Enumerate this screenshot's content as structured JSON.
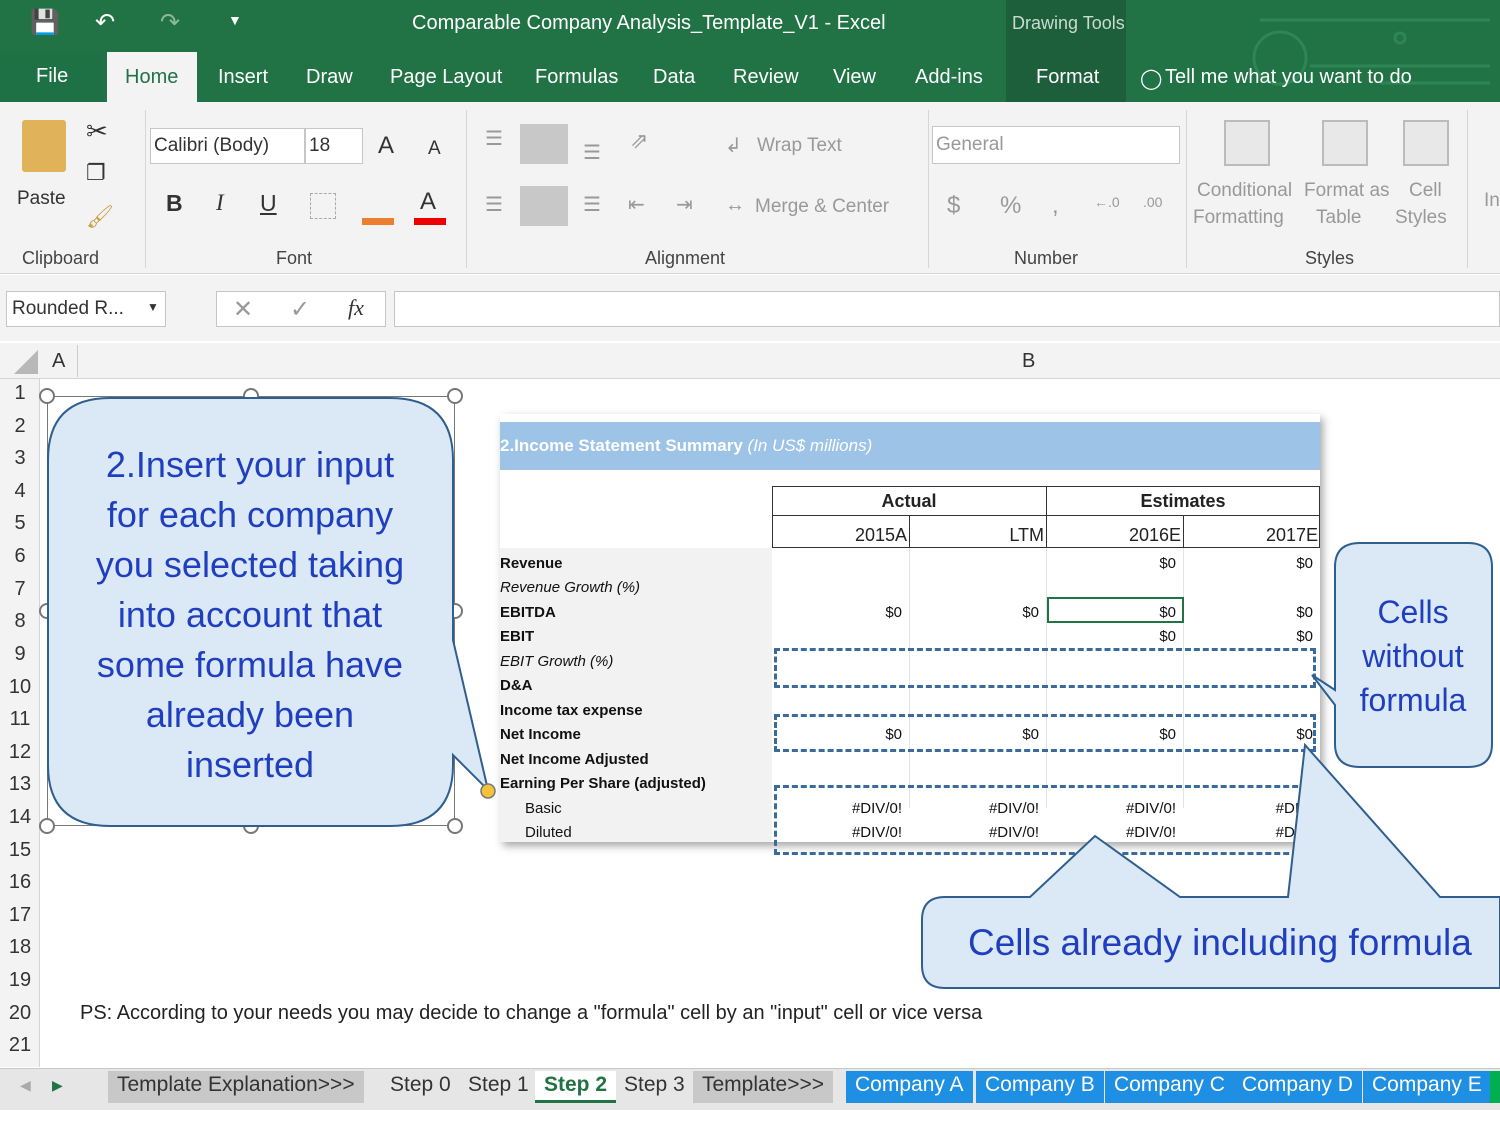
{
  "window": {
    "title": "Comparable Company Analysis_Template_V1 - Excel",
    "contextual": "Drawing Tools"
  },
  "tabs": [
    "File",
    "Home",
    "Insert",
    "Draw",
    "Page Layout",
    "Formulas",
    "Data",
    "Review",
    "View",
    "Add-ins",
    "Format"
  ],
  "tell_me": "Tell me what you want to do",
  "ribbon": {
    "paste": "Paste",
    "clipboard": "Clipboard",
    "font_name": "Calibri (Body)",
    "font_size": "18",
    "font": "Font",
    "wrap": "Wrap Text",
    "merge": "Merge & Center",
    "alignment": "Alignment",
    "number_format": "General",
    "number": "Number",
    "cond1": "Conditional",
    "cond2": "Formatting",
    "fmt1": "Format as",
    "fmt2": "Table",
    "cell1": "Cell",
    "cell2": "Styles",
    "styles": "Styles",
    "insert": "In"
  },
  "formula_bar": {
    "name_box": "Rounded R...",
    "fx": "fx"
  },
  "columns": [
    "A",
    "B"
  ],
  "rows": [
    "1",
    "2",
    "3",
    "4",
    "5",
    "6",
    "7",
    "8",
    "9",
    "10",
    "11",
    "12",
    "13",
    "14",
    "15",
    "16",
    "17",
    "18",
    "19",
    "20",
    "21"
  ],
  "callout_left": [
    "2.Insert your input",
    "for each company",
    "you selected taking",
    "into account that",
    "some formula have",
    "already been",
    "inserted"
  ],
  "callout_right": [
    "Cells",
    "without",
    "formula"
  ],
  "callout_bottom": "Cells already including formula",
  "table": {
    "title": "2.Income Statement Summary",
    "title_unit": "(In US$ millions)",
    "actual": "Actual",
    "estimates": "Estimates",
    "cols": [
      "2015A",
      "LTM",
      "2016E",
      "2017E"
    ],
    "rows": [
      {
        "label": "Revenue",
        "vals": [
          "",
          "",
          "$0",
          "$0"
        ]
      },
      {
        "label": "Revenue Growth (%)",
        "vals": [
          "",
          "",
          "",
          ""
        ]
      },
      {
        "label": "EBITDA",
        "vals": [
          "$0",
          "$0",
          "$0",
          "$0"
        ]
      },
      {
        "label": "EBIT",
        "vals": [
          "",
          "",
          "$0",
          "$0"
        ]
      },
      {
        "label": "EBIT Growth (%)",
        "vals": [
          "",
          "",
          "",
          ""
        ]
      },
      {
        "label": "D&A",
        "vals": [
          "",
          "",
          "",
          ""
        ]
      },
      {
        "label": "Income tax expense",
        "vals": [
          "",
          "",
          "",
          ""
        ]
      },
      {
        "label": "Net Income",
        "vals": [
          "$0",
          "$0",
          "$0",
          "$0"
        ]
      },
      {
        "label": "Net Income Adjusted",
        "vals": [
          "",
          "",
          "",
          ""
        ]
      },
      {
        "label": "Earning Per Share (adjusted)",
        "vals": [
          "",
          "",
          "",
          ""
        ]
      },
      {
        "label": "Basic",
        "vals": [
          "#DIV/0!",
          "#DIV/0!",
          "#DIV/0!",
          "#DI"
        ]
      },
      {
        "label": "Diluted",
        "vals": [
          "#DIV/0!",
          "#DIV/0!",
          "#DIV/0!",
          "#DI"
        ]
      }
    ]
  },
  "note": "PS: According to your needs you may decide to change a \"formula\" cell by an \"input\" cell or vice versa",
  "sheets": [
    "Template Explanation>>>",
    "Step 0",
    "Step 1",
    "Step 2",
    "Step 3",
    "Template>>>",
    "Company A",
    "Company B",
    "Company C",
    "Company D",
    "Company E"
  ]
}
